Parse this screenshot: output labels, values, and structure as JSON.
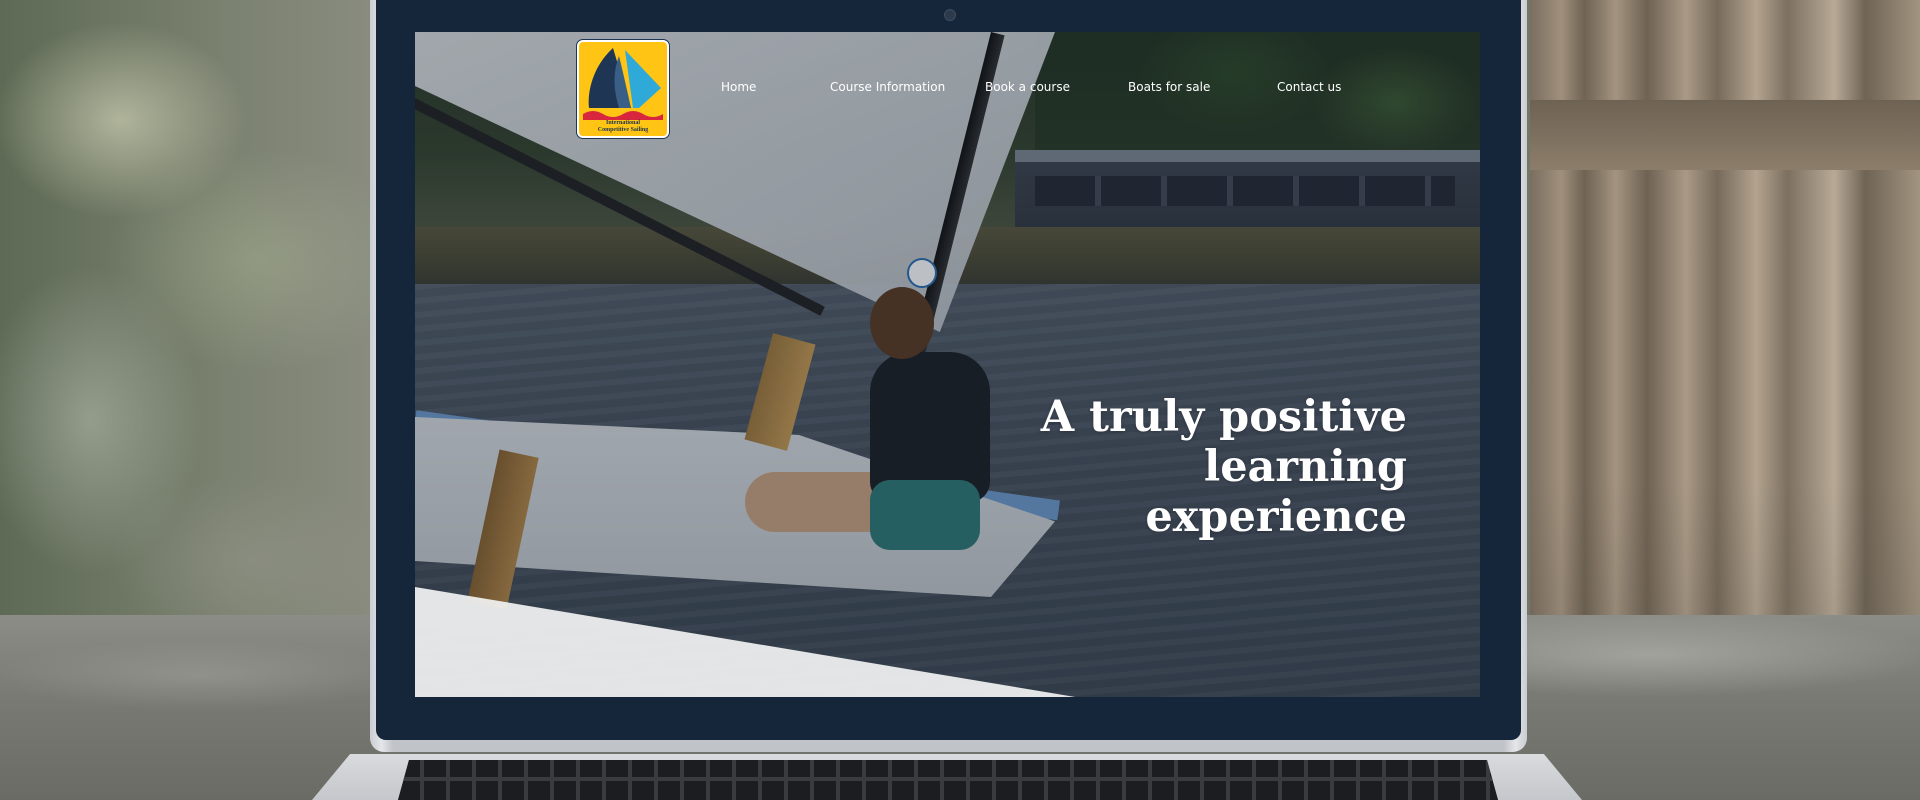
{
  "logo": {
    "line1": "International",
    "line2": "Competitive Sailing",
    "colors": {
      "background": "#ffc414",
      "sail_dark": "#1e3553",
      "sail_light": "#2fa9d8",
      "wave": "#d7263d"
    }
  },
  "nav": {
    "items": [
      {
        "label": "Home"
      },
      {
        "label": "Course Information"
      },
      {
        "label": "Book a course"
      },
      {
        "label": "Boats for sale"
      },
      {
        "label": "Contact us"
      }
    ]
  },
  "hero": {
    "headline_line1": "A truly positive",
    "headline_line2": "learning",
    "headline_line3": "experience"
  },
  "colors": {
    "bezel": "#15253a",
    "text_on_hero": "#ffffff",
    "accent": "#ffc414"
  }
}
